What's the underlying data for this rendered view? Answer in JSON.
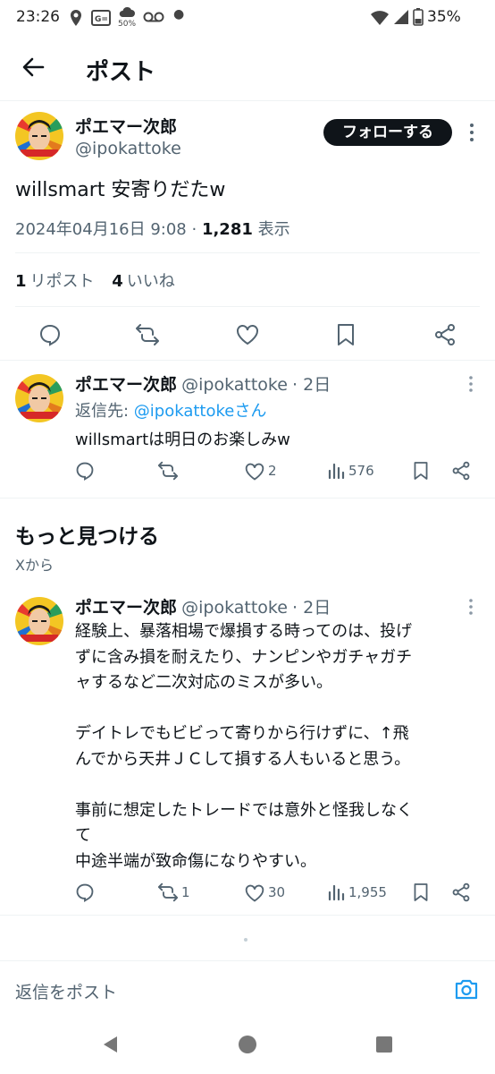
{
  "status_bar": {
    "time": "23:26",
    "net_speed": "50%",
    "battery": "35%"
  },
  "header": {
    "title": "ポスト"
  },
  "main_post": {
    "author_name": "ポエマー次郎",
    "author_handle": "@ipokattoke",
    "follow_label": "フォローする",
    "text": "willsmart 安寄りだたw",
    "datetime": "2024年04月16日 9:08",
    "separator": " · ",
    "views_count": "1,281",
    "views_label": " 表示",
    "reposts_count": "1",
    "reposts_label": "リポスト",
    "likes_count": "4",
    "likes_label": "いいね"
  },
  "reply_post": {
    "author_name": "ポエマー次郎",
    "author_handle": "@ipokattoke",
    "time_ago": "· 2日",
    "replying_to_prefix": "返信先: ",
    "replying_to_link": "@ipokattokeさん",
    "text": "willsmartは明日のお楽しみw",
    "likes": "2",
    "views": "576"
  },
  "discover": {
    "title": "もっと見つける",
    "subtitle": "Xから"
  },
  "discover_post": {
    "author_name": "ポエマー次郎",
    "author_handle": "@ipokattoke",
    "time_ago": "· 2日",
    "lines": [
      "経験上、暴落相場で爆損する時ってのは、投げ",
      "ずに含み損を耐えたり、ナンピンやガチャガチ",
      "ャするなど二次対応のミスが多い。",
      "",
      "デイトレでもビビって寄りから行けずに、↑飛",
      "んでから天井ＪＣして損する人もいると思う。",
      "",
      "事前に想定したトレードでは意外と怪我しなく",
      "て",
      "中途半端が致命傷になりやすい。"
    ],
    "reposts": "1",
    "likes": "30",
    "views": "1,955"
  },
  "reply_bar": {
    "placeholder": "返信をポスト"
  },
  "colors": {
    "accent": "#1d9bf0",
    "text_primary": "#0f1419",
    "text_secondary": "#536471",
    "divider": "#eff3f4"
  }
}
